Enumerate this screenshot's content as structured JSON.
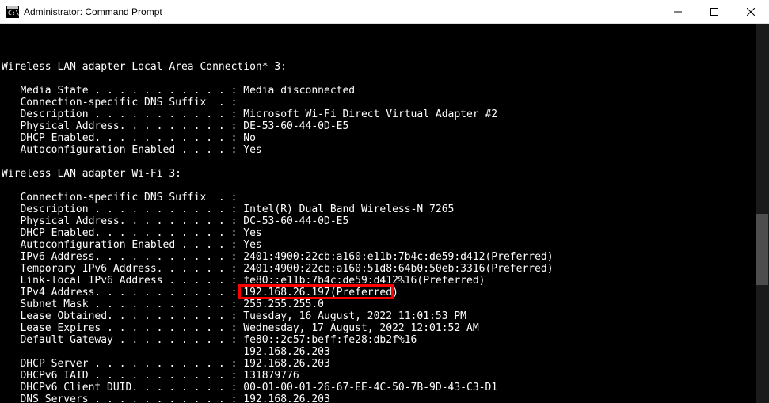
{
  "window": {
    "title": "Administrator: Command Prompt"
  },
  "terminal": {
    "lines": [
      "",
      "Wireless LAN adapter Local Area Connection* 3:",
      "",
      "   Media State . . . . . . . . . . . : Media disconnected",
      "   Connection-specific DNS Suffix  . :",
      "   Description . . . . . . . . . . . : Microsoft Wi-Fi Direct Virtual Adapter #2",
      "   Physical Address. . . . . . . . . : DE-53-60-44-0D-E5",
      "   DHCP Enabled. . . . . . . . . . . : No",
      "   Autoconfiguration Enabled . . . . : Yes",
      "",
      "Wireless LAN adapter Wi-Fi 3:",
      "",
      "   Connection-specific DNS Suffix  . :",
      "   Description . . . . . . . . . . . : Intel(R) Dual Band Wireless-N 7265",
      "   Physical Address. . . . . . . . . : DC-53-60-44-0D-E5",
      "   DHCP Enabled. . . . . . . . . . . : Yes",
      "   Autoconfiguration Enabled . . . . : Yes",
      "   IPv6 Address. . . . . . . . . . . : 2401:4900:22cb:a160:e11b:7b4c:de59:d412(Preferred)",
      "   Temporary IPv6 Address. . . . . . : 2401:4900:22cb:a160:51d8:64b0:50eb:3316(Preferred)",
      "   Link-local IPv6 Address . . . . . : fe80::e11b:7b4c:de59:d412%16(Preferred)",
      "   IPv4 Address. . . . . . . . . . . : 192.168.26.197(Preferred)",
      "   Subnet Mask . . . . . . . . . . . : 255.255.255.0",
      "   Lease Obtained. . . . . . . . . . : Tuesday, 16 August, 2022 11:01:53 PM",
      "   Lease Expires . . . . . . . . . . : Wednesday, 17 August, 2022 12:01:52 AM",
      "   Default Gateway . . . . . . . . . : fe80::2c57:beff:fe28:db2f%16",
      "                                       192.168.26.203",
      "   DHCP Server . . . . . . . . . . . : 192.168.26.203",
      "   DHCPv6 IAID . . . . . . . . . . . : 131879776",
      "   DHCPv6 Client DUID. . . . . . . . : 00-01-00-01-26-67-EE-4C-50-7B-9D-43-C3-D1",
      "   DNS Servers . . . . . . . . . . . : 192.168.26.203"
    ],
    "highlight": {
      "lineIndex": 20,
      "colStart": 38,
      "colEnd": 63
    }
  }
}
